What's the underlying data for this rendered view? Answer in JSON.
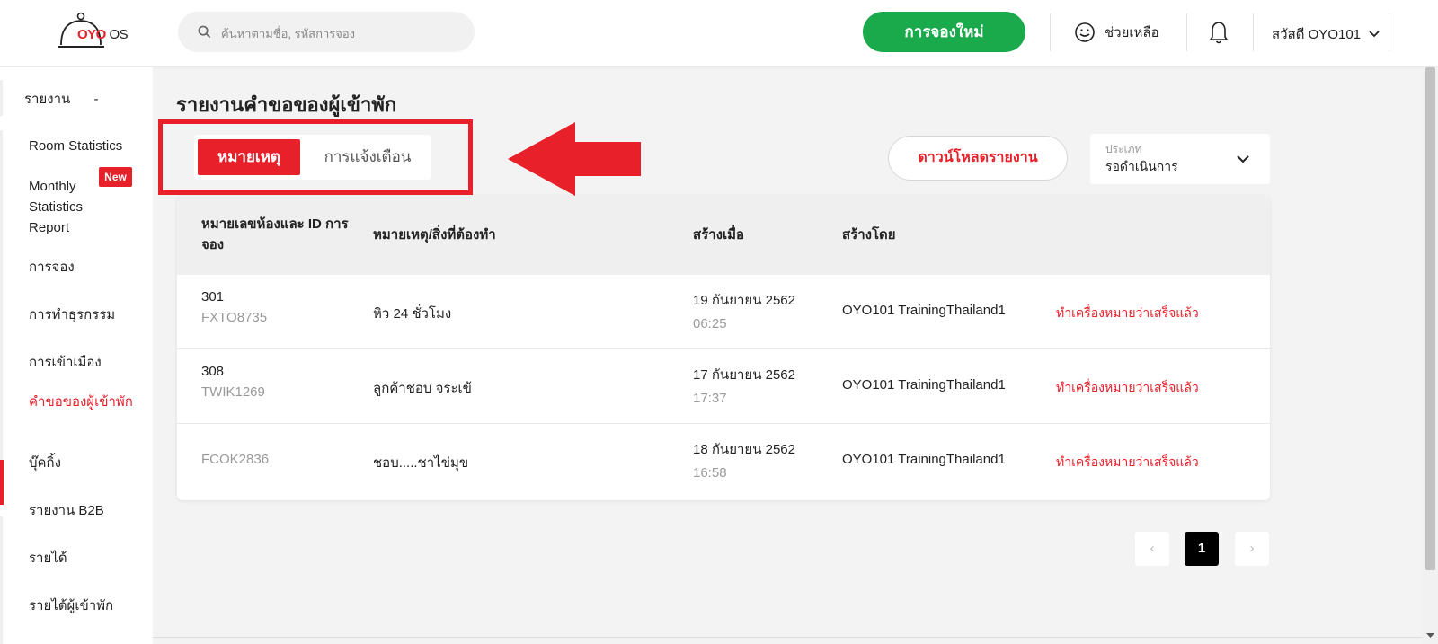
{
  "header": {
    "logo_text": "OYO",
    "logo_suffix": "OS",
    "search_placeholder": "ค้นหาตามชื่อ, รหัสการจอง",
    "new_booking_label": "การจองใหม่",
    "help_label": "ช่วยเหลือ",
    "user_label": "สวัสดี OYO101"
  },
  "sidebar": {
    "section_label": "รายงาน",
    "section_toggle": "-",
    "new_badge": "New",
    "items": [
      {
        "label": "Room Statistics"
      },
      {
        "label": "Monthly Statistics Report"
      },
      {
        "label": "การจอง"
      },
      {
        "label": "การทำธุรกรรม"
      },
      {
        "label": "การเข้าเมือง"
      },
      {
        "label": "คำขอของผู้เข้าพัก"
      },
      {
        "label": "บุ๊คกิ้ง"
      },
      {
        "label": "รายงาน B2B"
      },
      {
        "label": "รายได้"
      },
      {
        "label": "รายได้ผู้เข้าพัก"
      }
    ]
  },
  "main": {
    "title": "รายงานคำขอของผู้เข้าพัก",
    "tabs": [
      {
        "label": "หมายเหตุ",
        "active": true
      },
      {
        "label": "การแจ้งเตือน",
        "active": false
      }
    ],
    "download_label": "ดาวน์โหลดรายงาน",
    "type_select": {
      "label": "ประเภท",
      "value": "รอดำเนินการ"
    }
  },
  "table": {
    "headers": [
      "หมายเลขห้องและ ID การจอง",
      "หมายเหตุ/สิ่งที่ต้องทำ",
      "สร้างเมื่อ",
      "สร้างโดย"
    ],
    "rows": [
      {
        "room": "301",
        "booking_id": "FXTO8735",
        "note": "หิว 24 ชั่วโมง",
        "date": "19 กันยายน 2562",
        "time": "06:25",
        "created_by": "OYO101 TrainingThailand1",
        "action": "ทำเครื่องหมายว่าเสร็จแล้ว"
      },
      {
        "room": "308",
        "booking_id": "TWIK1269",
        "note": "ลูกค้าชอบ จระเข้",
        "date": "17 กันยายน 2562",
        "time": "17:37",
        "created_by": "OYO101 TrainingThailand1",
        "action": "ทำเครื่องหมายว่าเสร็จแล้ว"
      },
      {
        "room": "",
        "booking_id": "FCOK2836",
        "note": "ชอบ.....ชาไข่มุข",
        "date": "18 กันยายน 2562",
        "time": "16:58",
        "created_by": "OYO101 TrainingThailand1",
        "action": "ทำเครื่องหมายว่าเสร็จแล้ว"
      }
    ]
  },
  "pagination": {
    "prev": "‹",
    "current": "1",
    "next": "›"
  },
  "colors": {
    "brand_red": "#e8202a",
    "booking_green": "#1aaa4b"
  }
}
